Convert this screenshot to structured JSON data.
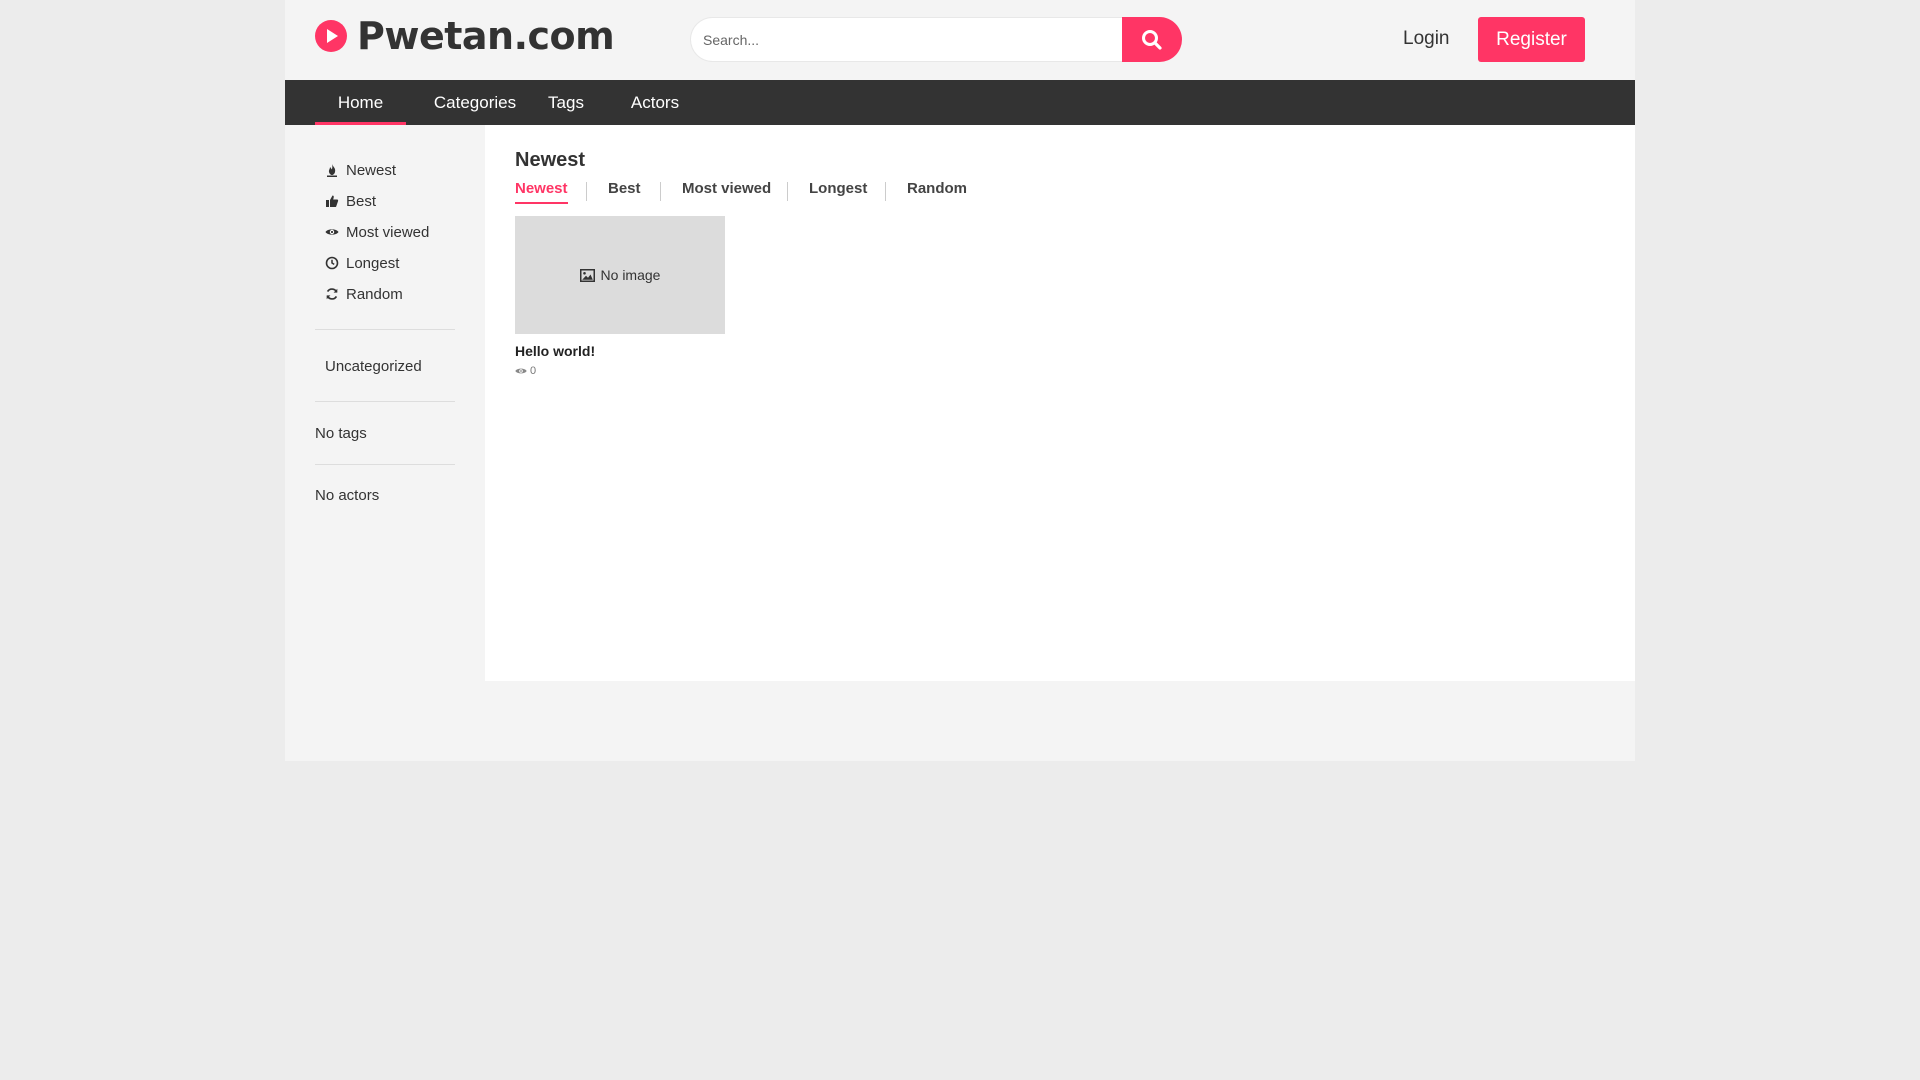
{
  "header": {
    "logo_text": "Pwetan.com",
    "search_placeholder": "Search...",
    "login_label": "Login",
    "register_label": "Register"
  },
  "nav": {
    "items": [
      {
        "label": "Home",
        "active": true
      },
      {
        "label": "Categories"
      },
      {
        "label": "Tags"
      },
      {
        "label": "Actors"
      }
    ]
  },
  "sidebar": {
    "filters": [
      {
        "label": "Newest",
        "icon": "fire-icon"
      },
      {
        "label": "Best",
        "icon": "thumbs-up-icon"
      },
      {
        "label": "Most viewed",
        "icon": "eye-icon"
      },
      {
        "label": "Longest",
        "icon": "clock-icon"
      },
      {
        "label": "Random",
        "icon": "refresh-icon"
      }
    ],
    "category": "Uncategorized",
    "tags_text": "No tags",
    "actors_text": "No actors"
  },
  "main": {
    "title": "Newest",
    "tabs": [
      {
        "label": "Newest",
        "active": true
      },
      {
        "label": "Best"
      },
      {
        "label": "Most viewed"
      },
      {
        "label": "Longest"
      },
      {
        "label": "Random"
      }
    ],
    "videos": [
      {
        "thumbnail_text": "No image",
        "title": "Hello world!",
        "views": "0"
      }
    ]
  },
  "colors": {
    "accent": "#ff3565",
    "nav_bg": "#333333",
    "page_bg": "#ececec"
  }
}
